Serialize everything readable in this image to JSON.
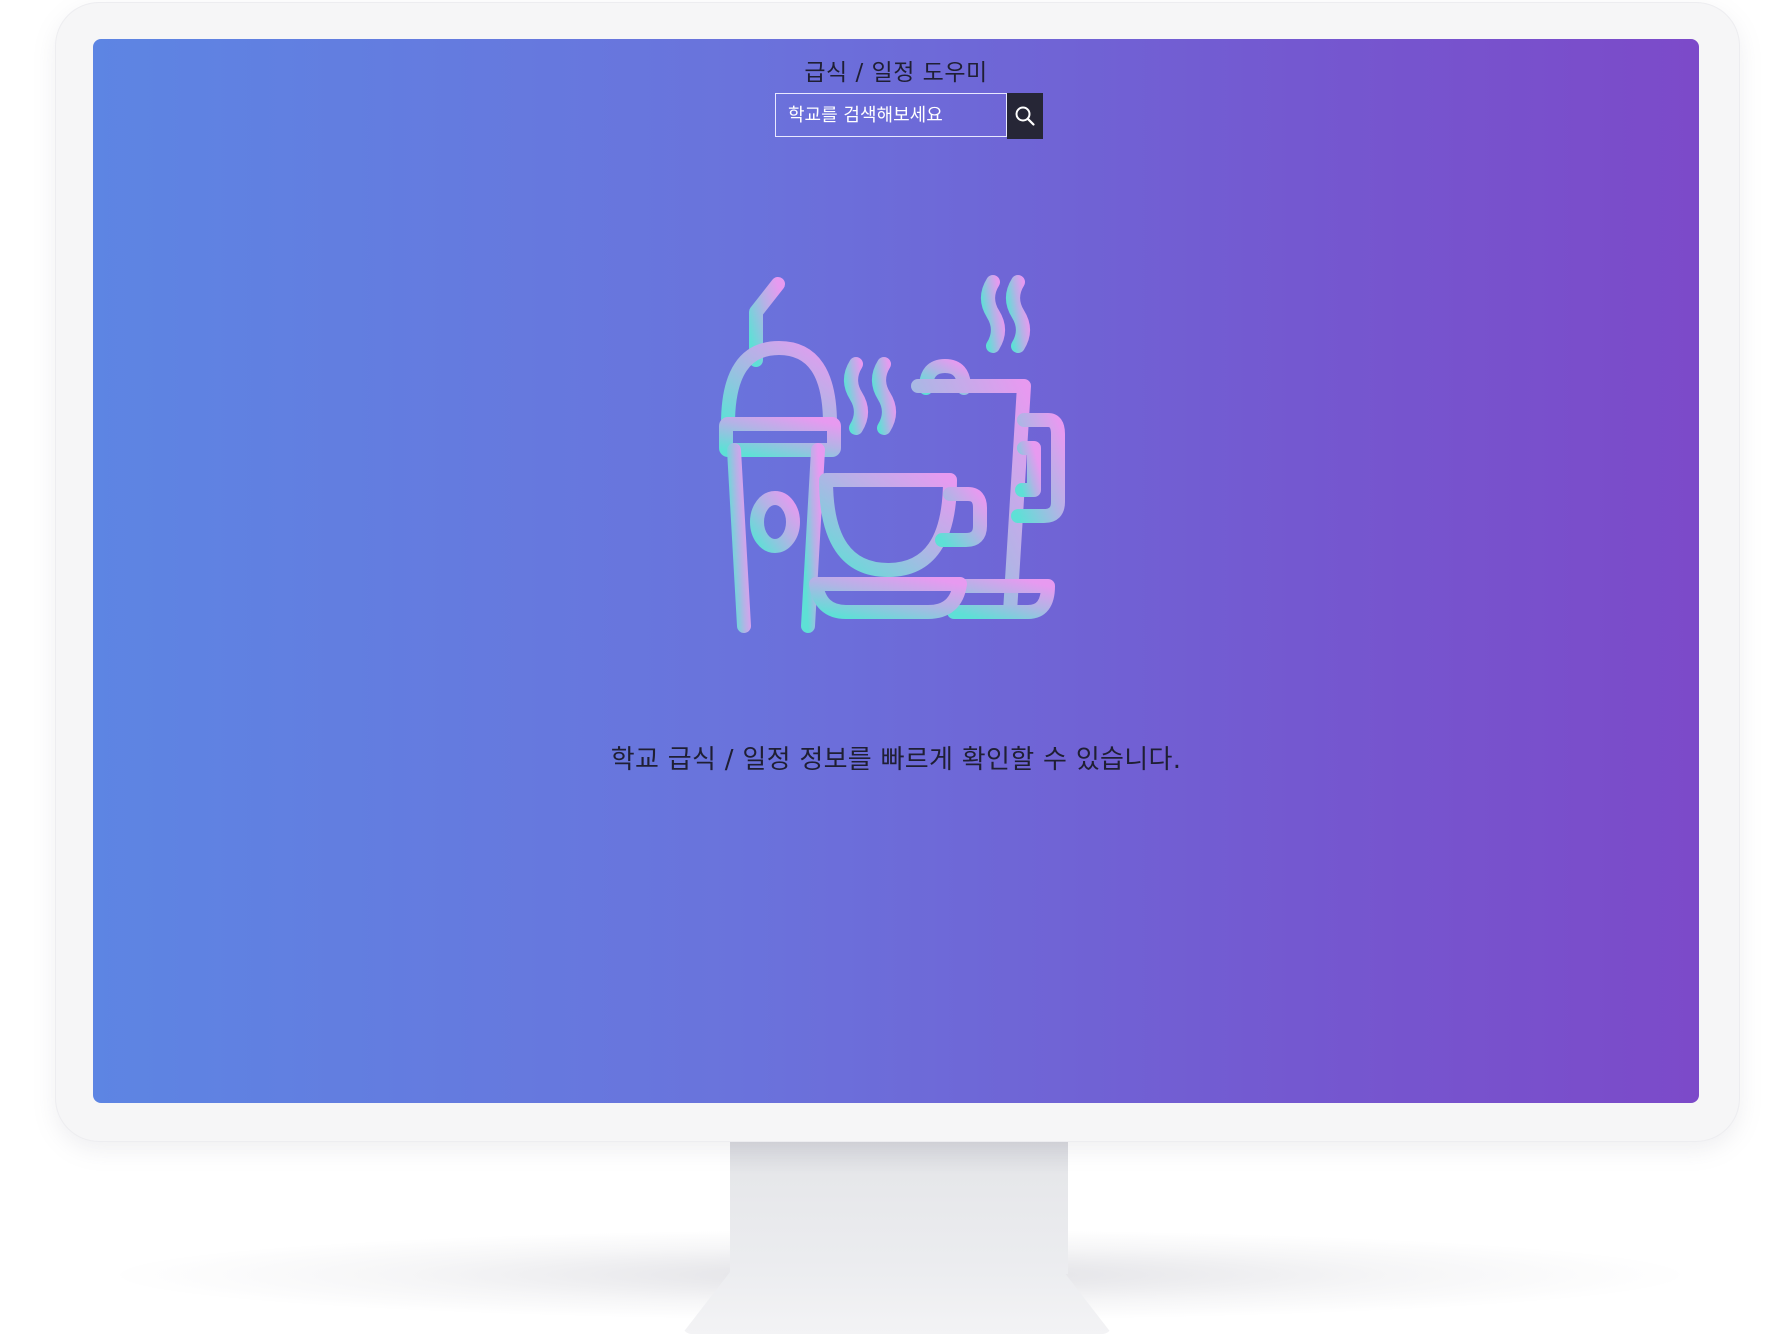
{
  "app": {
    "title": "급식 / 일정 도우미"
  },
  "search": {
    "placeholder": "학교를 검색해보세요",
    "button_icon": "search-icon"
  },
  "hero": {
    "illustration_icon": "cafe-drinks-icon",
    "tagline": "학교 급식 / 일정 정보를 빠르게 확인할 수 있습니다."
  },
  "colors": {
    "screen_gradient_start": "#5d85e3",
    "screen_gradient_end": "#7c4ac9",
    "icon_gradient_start": "#5ee0d6",
    "icon_gradient_end": "#e79af0",
    "search_button_bg": "#262636",
    "text_dark": "#1f1f33"
  }
}
